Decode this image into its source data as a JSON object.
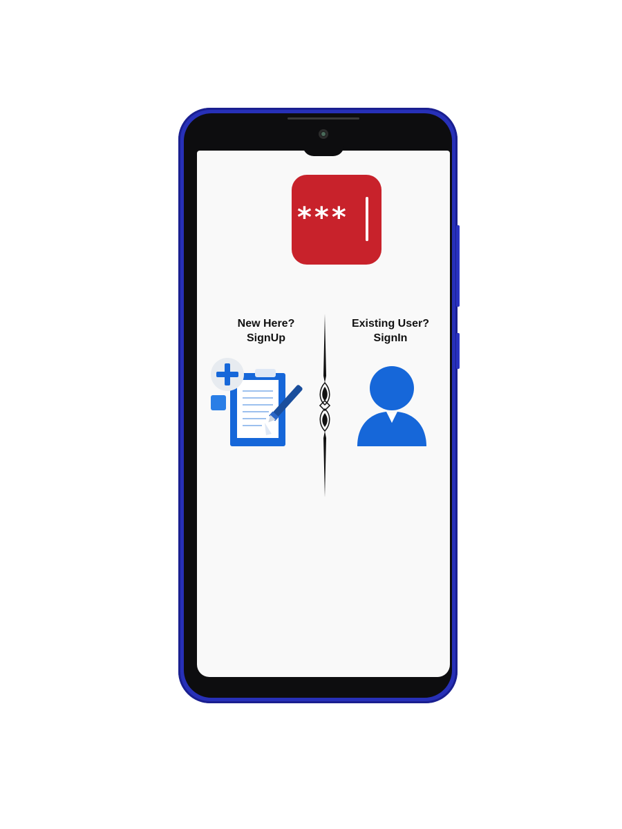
{
  "logo": {
    "text": "***",
    "icon": "password-field-icon",
    "color": "#c8222b"
  },
  "signup": {
    "line1": "New Here?",
    "line2": "SignUp",
    "icon": "clipboard-add-icon",
    "color": "#1667d9"
  },
  "signin": {
    "line1": "Existing User?",
    "line2": "SignIn",
    "icon": "user-icon",
    "color": "#1667d9"
  },
  "device": {
    "frame_color": "#2730b8"
  }
}
